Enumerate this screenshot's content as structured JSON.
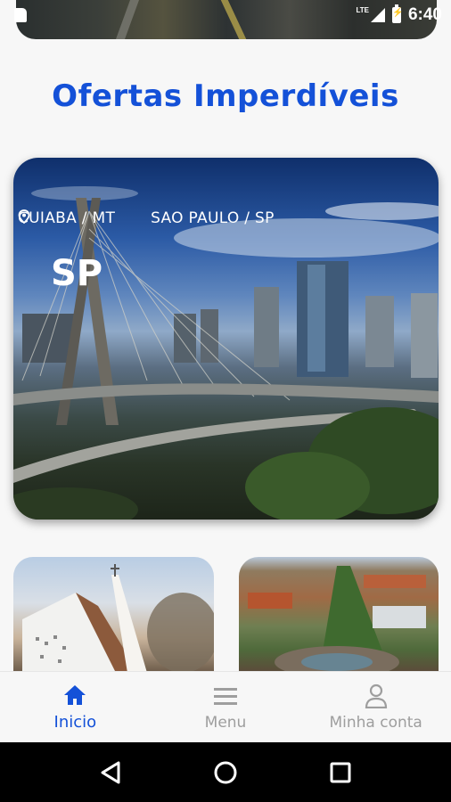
{
  "status_bar": {
    "network": "LTE",
    "time": "6:40"
  },
  "heading": "Ofertas Imperdíveis",
  "hero": {
    "origin_city": "CUIABA / MT",
    "destination_city": "SAO PAULO / SP",
    "state": "SP"
  },
  "offer_cards": [
    {
      "image_subject": "church"
    },
    {
      "image_subject": "aerial-city"
    }
  ],
  "bottom_nav": {
    "items": [
      {
        "label": "Inicio",
        "icon": "home-icon",
        "active": true
      },
      {
        "label": "Menu",
        "icon": "menu-icon",
        "active": false
      },
      {
        "label": "Minha conta",
        "icon": "user-icon",
        "active": false
      }
    ]
  },
  "colors": {
    "accent": "#1451d8",
    "inactive": "#9e9e9e"
  }
}
